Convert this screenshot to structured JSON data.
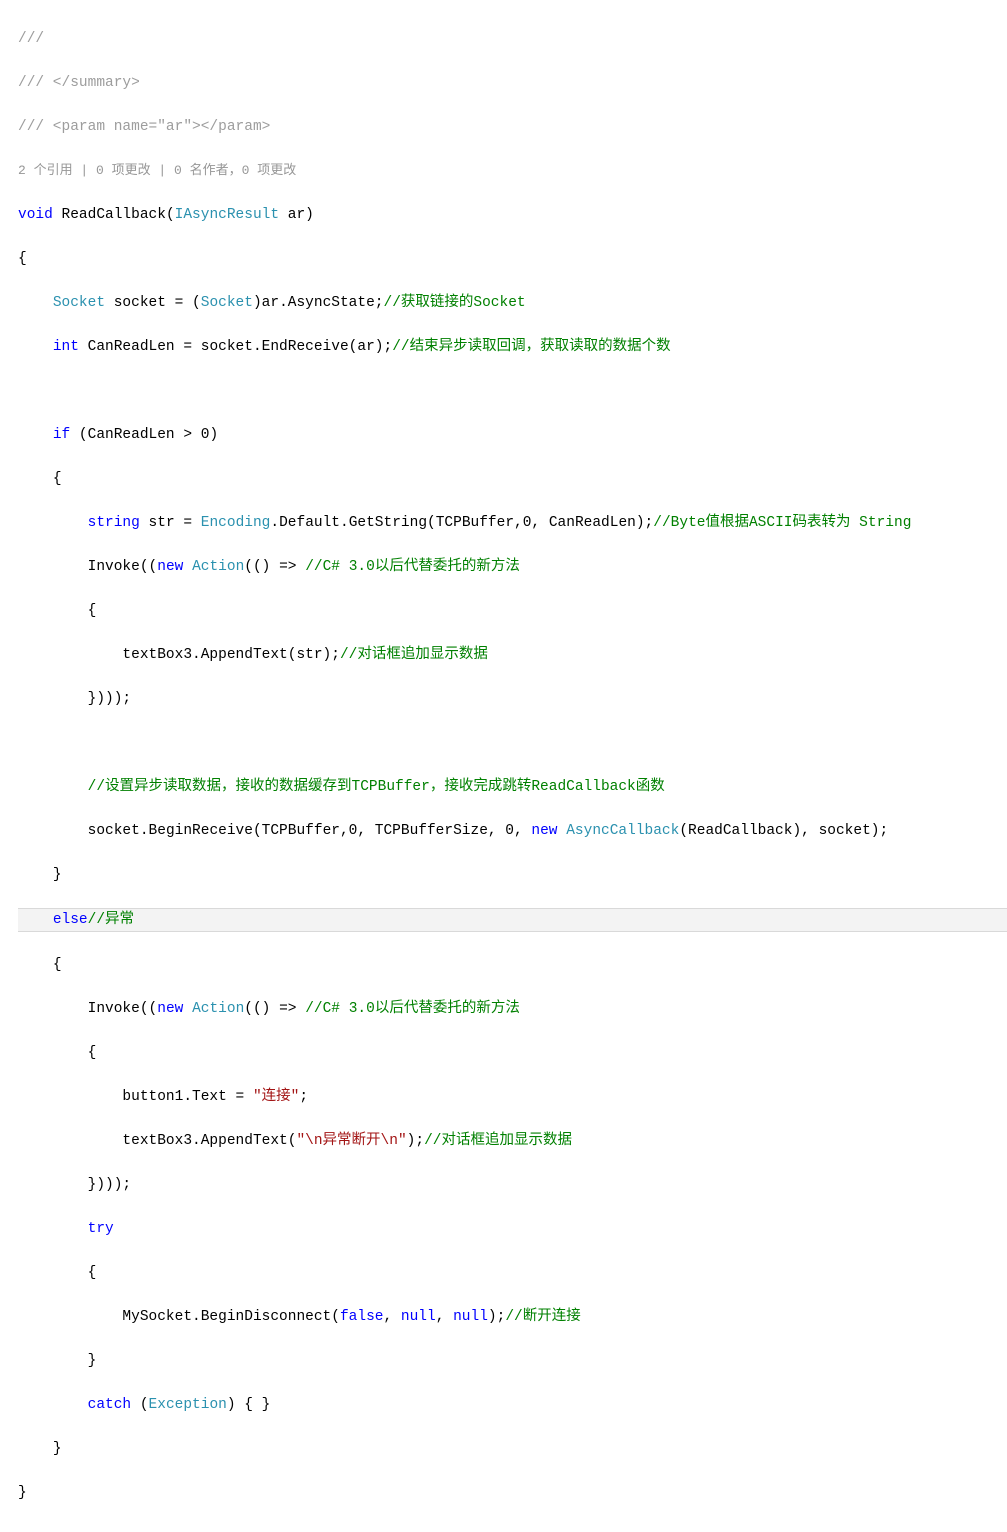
{
  "codelens": "2 个引用 | 0 项更改 | 0 名作者，0 项更改",
  "xml": {
    "slashes": "///",
    "summary_close": " </summary>",
    "param": " <param name=\"ar\"></param>"
  },
  "kw": {
    "void": "void",
    "int": "int",
    "if": "if",
    "else": "else",
    "new": "new",
    "string": "string",
    "try": "try",
    "catch": "catch",
    "false": "false",
    "null": "null"
  },
  "ty": {
    "Socket": "Socket",
    "IAsyncResult": "IAsyncResult",
    "Encoding": "Encoding",
    "Action": "Action",
    "AsyncCallback": "AsyncCallback",
    "Exception": "Exception"
  },
  "fn": {
    "name": "ReadCallback",
    "param": "ar"
  },
  "str": {
    "connect": "\"连接\"",
    "disconnect": "\"\\n异常断开\\n\""
  },
  "cmt": {
    "get_socket": "//获取链接的Socket",
    "end_recv": "//结束异步读取回调，获取读取的数据个数",
    "byte_ascii": "//Byte值根据ASCII码表转为 String",
    "action": "//C# 3.0以后代替委托的新方法",
    "append": "//对话框追加显示数据",
    "begin_recv": "//设置异步读取数据，接收的数据缓存到TCPBuffer，接收完成跳转ReadCallback函数",
    "else": "//异常",
    "disconnect": "//断开连接"
  },
  "code": {
    "sock_decl": " socket = (",
    "sock_cast": ")ar.AsyncState;",
    "canread": " CanReadLen = socket.EndReceive(ar);",
    "if_cond": " (CanReadLen > 0)",
    "obrace": "{",
    "cbrace": "}",
    "str_assign": " str = ",
    "encode": ".Default.GetString(TCPBuffer,0, CanReadLen);",
    "invoke_open": "Invoke((",
    "action_open": "(() => ",
    "append_text": "textBox3.AppendText(str);",
    "invoke_close": "})));",
    "begin_recv": "socket.BeginReceive(TCPBuffer,0, TCPBufferSize, 0, ",
    "begin_recv2": "(ReadCallback), socket);",
    "btn_text": "button1.Text = ",
    "semicolon": ";",
    "append2": "textBox3.AppendText(",
    "append2_close": ");",
    "disconnect": "MySocket.BeginDisconnect(",
    "comma": ", ",
    "catch_body": ") { }",
    "space_paren": " ("
  }
}
